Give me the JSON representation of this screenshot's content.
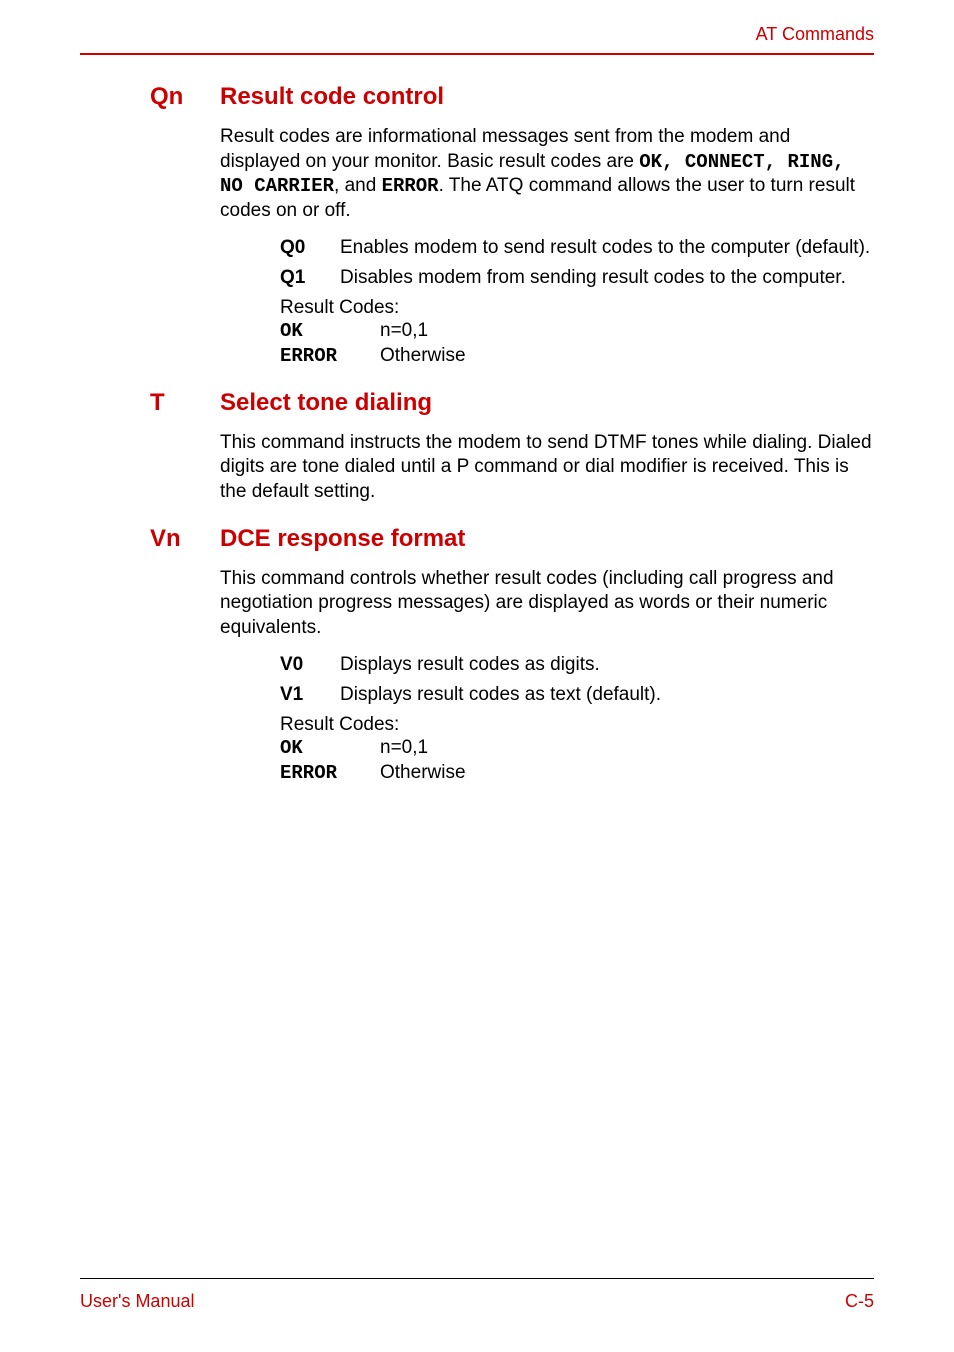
{
  "header": {
    "title": "AT Commands"
  },
  "sections": [
    {
      "cmd": "Qn",
      "title": "Result code control",
      "intro_parts": {
        "p1": "Result codes are informational messages sent from the modem and displayed on your monitor. Basic result codes are ",
        "code1": "OK, CONNECT, RING, NO CARRIER",
        "mid1": ", and ",
        "code2": "ERROR",
        "p2": ". The ATQ command allows the user to turn result codes on or off."
      },
      "params": [
        {
          "label": "Q0",
          "desc": "Enables modem to send result codes to the computer (default)."
        },
        {
          "label": "Q1",
          "desc": "Disables modem from sending result codes to the computer."
        }
      ],
      "result_label": "Result Codes:",
      "results": [
        {
          "code": "OK",
          "desc": "n=0,1"
        },
        {
          "code": "ERROR",
          "desc": "Otherwise"
        }
      ]
    },
    {
      "cmd": "T",
      "title": "Select tone dialing",
      "intro": "This command instructs the modem to send DTMF tones while dialing. Dialed digits are tone dialed until a P command or dial modifier is received. This is the default setting."
    },
    {
      "cmd": "Vn",
      "title": "DCE response format",
      "intro": "This command controls whether result codes (including call progress and negotiation progress messages) are displayed as words or their numeric equivalents.",
      "params": [
        {
          "label": "V0",
          "desc": "Displays result codes as digits."
        },
        {
          "label": "V1",
          "desc": "Displays result codes as text (default)."
        }
      ],
      "result_label": "Result Codes:",
      "results": [
        {
          "code": "OK",
          "desc": "n=0,1"
        },
        {
          "code": "ERROR",
          "desc": "Otherwise"
        }
      ]
    }
  ],
  "footer": {
    "left": "User's Manual",
    "right": "C-5"
  }
}
